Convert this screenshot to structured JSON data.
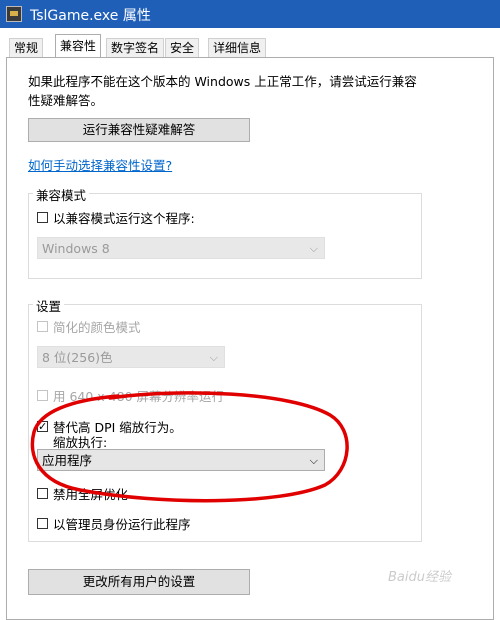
{
  "window": {
    "title": "TslGame.exe 属性"
  },
  "tabs": [
    {
      "label": "常规"
    },
    {
      "label": "兼容性"
    },
    {
      "label": "数字签名"
    },
    {
      "label": "安全"
    },
    {
      "label": "详细信息"
    }
  ],
  "intro": {
    "line1": "如果此程序不能在这个版本的 Windows 上正常工作，请尝试运行兼容",
    "line2": "性疑难解答。"
  },
  "troubleshoot_button": "运行兼容性疑难解答",
  "manual_link": "如何手动选择兼容性设置?",
  "compat_mode": {
    "title": "兼容模式",
    "checkbox_label": "以兼容模式运行这个程序:",
    "os_value": "Windows 8"
  },
  "settings": {
    "title": "设置",
    "reduced_color_label": "简化的颜色模式",
    "color_value": "8 位(256)色",
    "resolution_label": "用 640 x 480 屏幕分辨率运行",
    "dpi_label": "替代高 DPI 缩放行为。",
    "dpi_sub_label": "缩放执行:",
    "dpi_value": "应用程序",
    "fullscreen_label": "禁用全屏优化",
    "admin_label": "以管理员身份运行此程序"
  },
  "all_users_button": "更改所有用户的设置",
  "check_mark": "✓",
  "chevron": "⌵",
  "watermark": "Baidu经验",
  "colors": {
    "title_bar": "#1f5fb8",
    "annotation": "#e00000"
  },
  "icons": {
    "app": "pubg-game-icon"
  }
}
